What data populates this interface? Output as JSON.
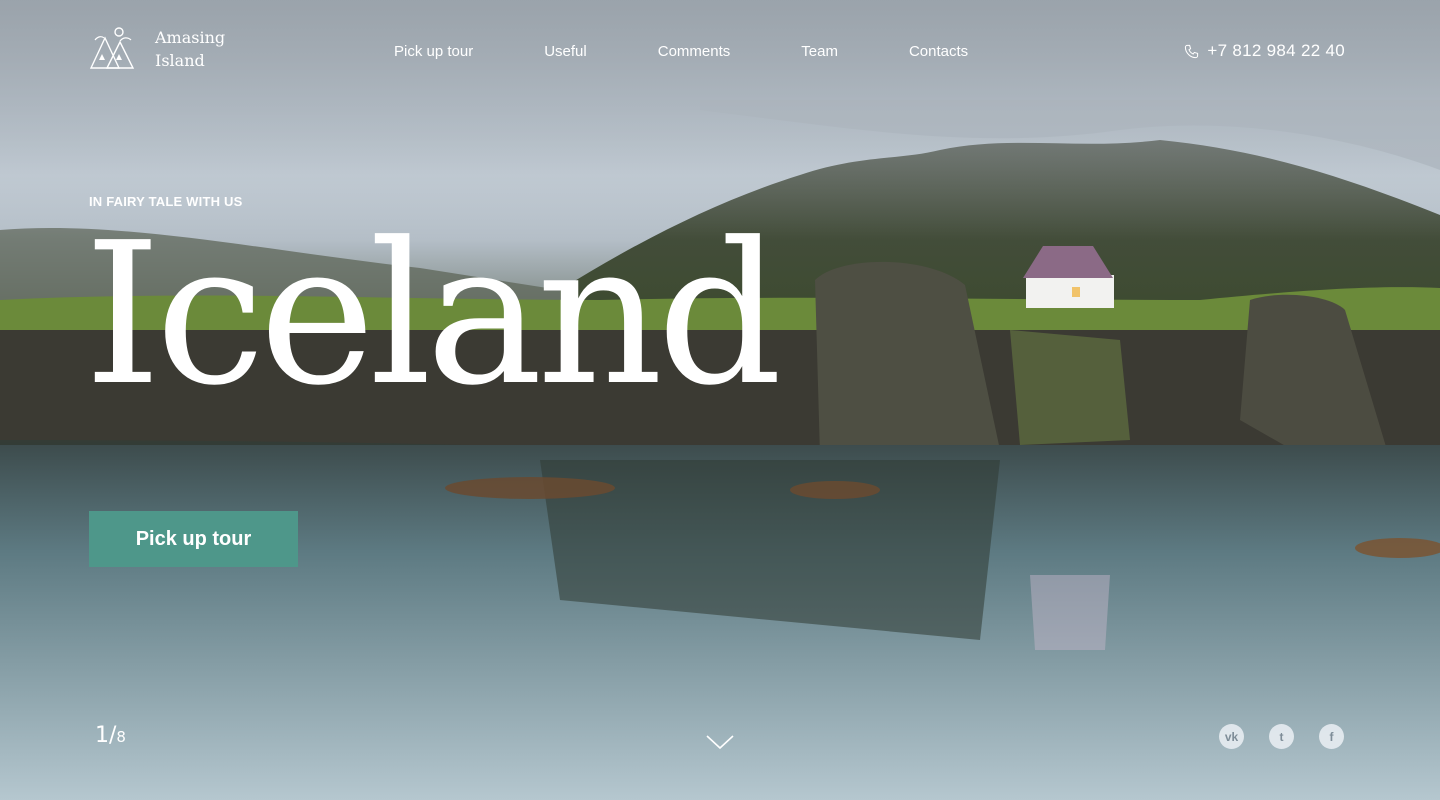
{
  "brand": {
    "line1": "Amasing",
    "line2": "Island"
  },
  "nav": [
    {
      "label": "Pick up tour"
    },
    {
      "label": "Useful"
    },
    {
      "label": "Comments"
    },
    {
      "label": "Team"
    },
    {
      "label": "Contacts"
    }
  ],
  "phone": {
    "number": "+7 812 984 22 40",
    "icon": "phone-icon"
  },
  "hero": {
    "kicker": "IN FAIRY TALE WITH US",
    "title": "Iceland",
    "cta_label": "Pick up tour"
  },
  "pager": {
    "current": "1",
    "separator": "/",
    "total": "8"
  },
  "socials": [
    {
      "name": "vk-icon",
      "glyph": "vk"
    },
    {
      "name": "twitter-icon",
      "glyph": "t"
    },
    {
      "name": "facebook-icon",
      "glyph": "f"
    }
  ],
  "colors": {
    "accent": "#4e978a"
  }
}
